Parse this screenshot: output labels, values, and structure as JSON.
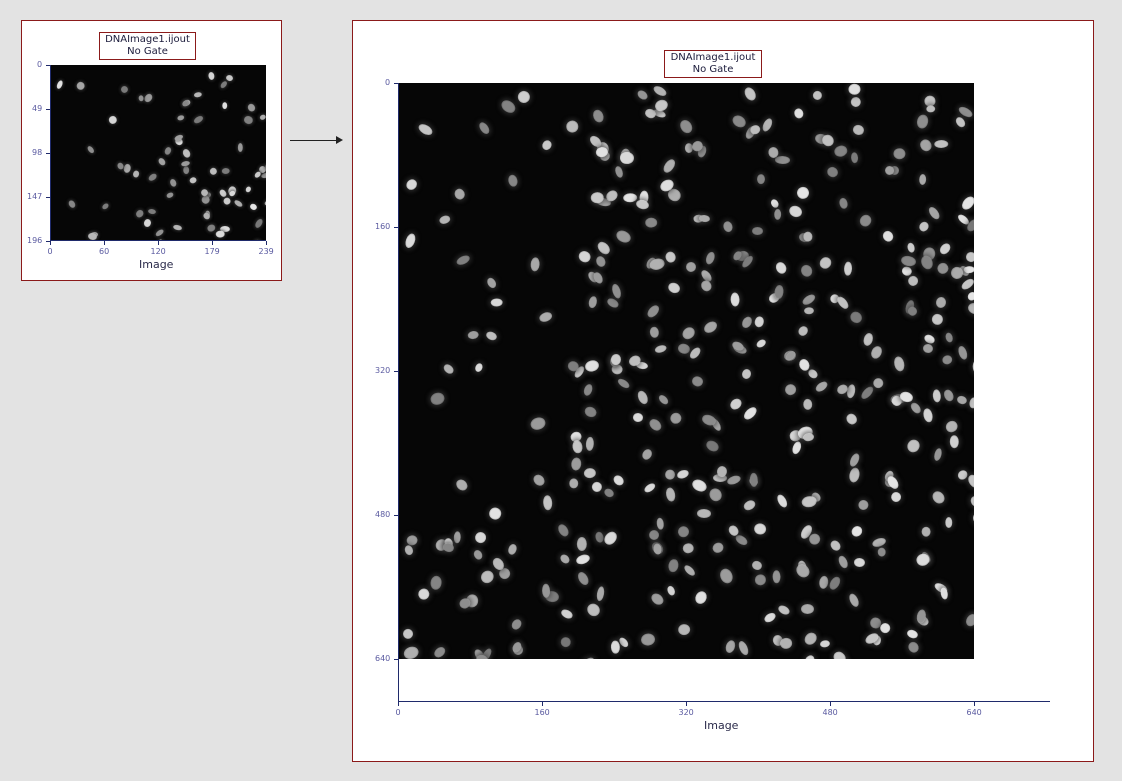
{
  "small_plot": {
    "title_line1": "DNAImage1.ijout",
    "title_line2": "No Gate",
    "x_axis_label": "Image",
    "x_ticks": [
      "0",
      "60",
      "120",
      "179",
      "239"
    ],
    "y_ticks": [
      "0",
      "49",
      "98",
      "147",
      "196"
    ]
  },
  "large_plot": {
    "title_line1": "DNAImage1.ijout",
    "title_line2": "No Gate",
    "x_axis_label": "Image",
    "x_ticks": [
      "0",
      "160",
      "320",
      "480",
      "640"
    ],
    "y_ticks": [
      "0",
      "160",
      "320",
      "480",
      "640"
    ]
  },
  "colors": {
    "panel_border": "#8b1a1a",
    "axis": "#1f2a6b",
    "tick_label": "#5a5aa0",
    "background": "#e3e3e3"
  },
  "icons": {
    "expand_arrow": "right-arrow-icon"
  }
}
